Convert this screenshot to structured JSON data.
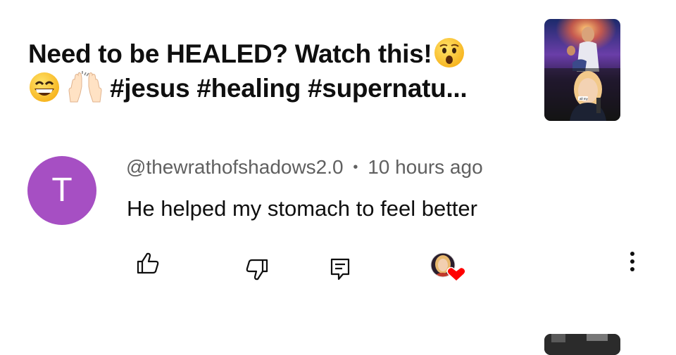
{
  "video": {
    "title_line1": "Need to be HEALED? Watch this!",
    "title_line2_tags": "#jesus #healing #supernatu...",
    "emojis": [
      "astonished-face",
      "grinning-face-with-smiling-eyes",
      "raising-hands"
    ],
    "thumbnail_caption": "all my"
  },
  "comment": {
    "avatar_letter": "T",
    "avatar_color": "#a64fc3",
    "author": "@thewrathofshadows2.0",
    "separator": "•",
    "time": "10 hours ago",
    "text": "He helped my stomach to feel better"
  },
  "actions": {
    "icons": [
      "thumbs-up-icon",
      "thumbs-down-icon",
      "reply-icon",
      "creator-heart-icon",
      "more-vertical-icon"
    ],
    "heart_color": "#ff0000"
  }
}
